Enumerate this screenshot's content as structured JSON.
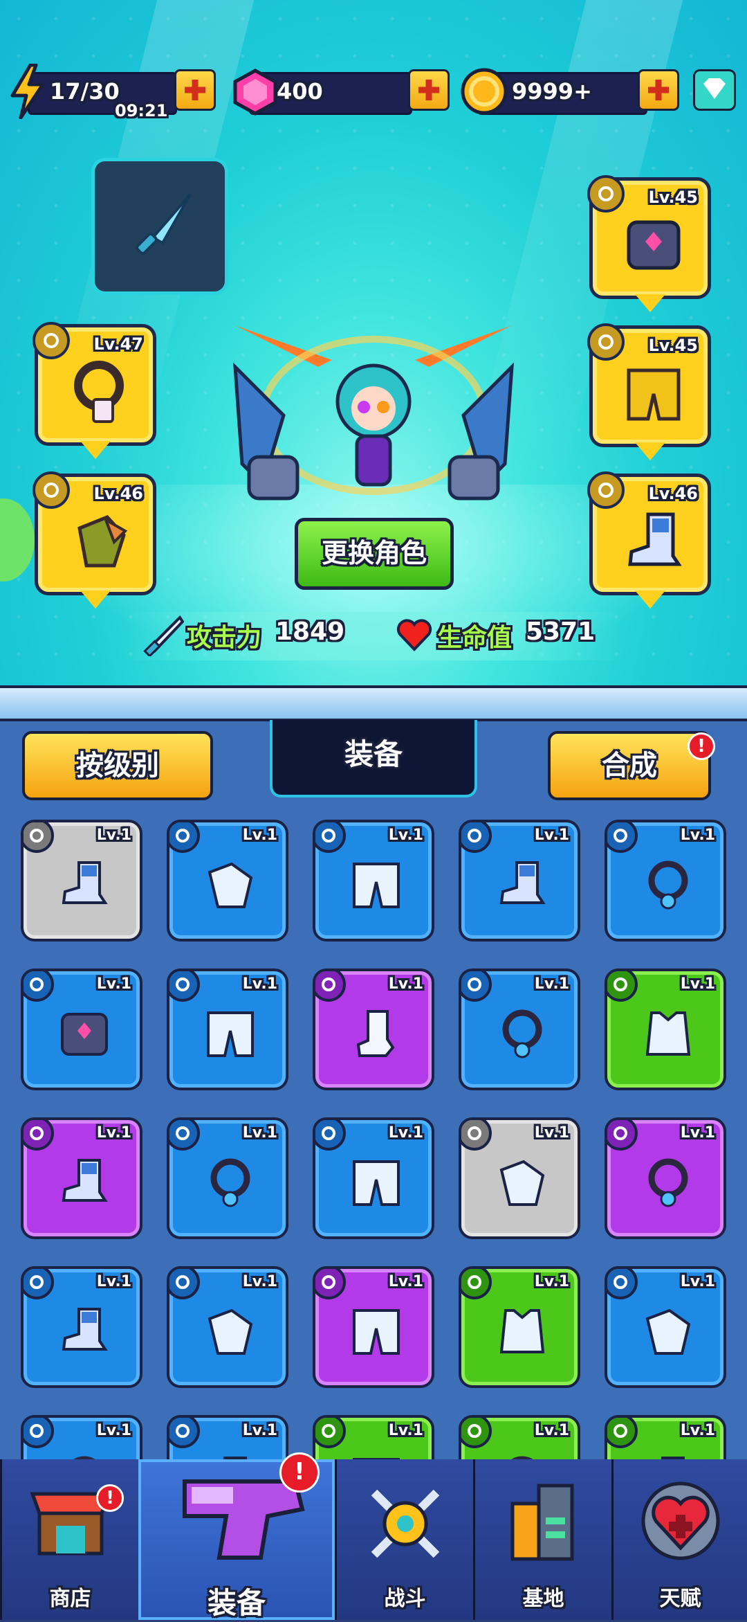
{
  "resources": {
    "energy": {
      "value": "17/30",
      "timer": "09:21",
      "icon": "lightning-icon"
    },
    "gems": {
      "value": "400",
      "icon": "gem-icon"
    },
    "coins": {
      "value": "9999+",
      "icon": "coin-icon"
    }
  },
  "equipped": {
    "left": [
      {
        "level": "Lv.47",
        "icon": "necklace-icon"
      },
      {
        "level": "Lv.46",
        "icon": "glove-icon"
      }
    ],
    "right": [
      {
        "level": "Lv.45",
        "icon": "armor-icon"
      },
      {
        "level": "Lv.45",
        "icon": "pants-icon"
      },
      {
        "level": "Lv.46",
        "icon": "boot-icon"
      }
    ]
  },
  "hero": {
    "change_button": "更换角色",
    "attack_label": "攻击力",
    "attack_value": "1849",
    "hp_label": "生命值",
    "hp_value": "5371"
  },
  "panel": {
    "sort_button": "按级别",
    "title": "装备",
    "merge_button": "合成",
    "merge_badge": "!"
  },
  "inventory": [
    {
      "level": "Lv.1",
      "rarity": "gray",
      "item": "boot"
    },
    {
      "level": "Lv.1",
      "rarity": "blue",
      "item": "glove"
    },
    {
      "level": "Lv.1",
      "rarity": "blue",
      "item": "pants"
    },
    {
      "level": "Lv.1",
      "rarity": "blue",
      "item": "boot"
    },
    {
      "level": "Lv.1",
      "rarity": "blue",
      "item": "necklace"
    },
    {
      "level": "Lv.1",
      "rarity": "blue",
      "item": "armor"
    },
    {
      "level": "Lv.1",
      "rarity": "blue",
      "item": "pants"
    },
    {
      "level": "Lv.1",
      "rarity": "purple",
      "item": "sock"
    },
    {
      "level": "Lv.1",
      "rarity": "blue",
      "item": "necklace"
    },
    {
      "level": "Lv.1",
      "rarity": "green",
      "item": "vest"
    },
    {
      "level": "Lv.1",
      "rarity": "purple",
      "item": "boot"
    },
    {
      "level": "Lv.1",
      "rarity": "blue",
      "item": "necklace"
    },
    {
      "level": "Lv.1",
      "rarity": "blue",
      "item": "pants"
    },
    {
      "level": "Lv.1",
      "rarity": "gray",
      "item": "glove"
    },
    {
      "level": "Lv.1",
      "rarity": "purple",
      "item": "necklace"
    },
    {
      "level": "Lv.1",
      "rarity": "blue",
      "item": "boot"
    },
    {
      "level": "Lv.1",
      "rarity": "blue",
      "item": "glove"
    },
    {
      "level": "Lv.1",
      "rarity": "purple",
      "item": "pants"
    },
    {
      "level": "Lv.1",
      "rarity": "green",
      "item": "vest"
    },
    {
      "level": "Lv.1",
      "rarity": "blue",
      "item": "glove"
    },
    {
      "level": "Lv.1",
      "rarity": "blue",
      "item": "necklace"
    },
    {
      "level": "Lv.1",
      "rarity": "blue",
      "item": "boot"
    },
    {
      "level": "Lv.1",
      "rarity": "green",
      "item": "pants"
    },
    {
      "level": "Lv.1",
      "rarity": "green",
      "item": "necklace"
    },
    {
      "level": "Lv.1",
      "rarity": "green",
      "item": "boot"
    }
  ],
  "nav": {
    "shop": "商店",
    "equipment": "装备",
    "battle": "战斗",
    "base": "基地",
    "talent": "天赋",
    "badge": "!"
  },
  "colors": {
    "accent_yellow": "#ffd01e",
    "panel_blue": "#3d6fb8",
    "alert_red": "#e61d28"
  }
}
